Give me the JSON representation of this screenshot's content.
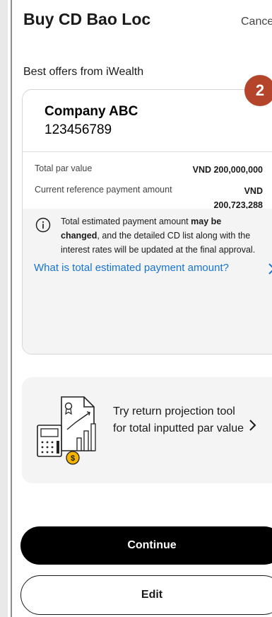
{
  "header": {
    "title": "Buy CD Bao Loc",
    "cancel_label": "Cance"
  },
  "section_title": "Best offers from iWealth",
  "step_badge": "2",
  "offer": {
    "company_name": "Company ABC",
    "company_code": "123456789",
    "rows": [
      {
        "label": "Total par value",
        "value": "VND 200,000,000"
      },
      {
        "label": "Current reference payment amount",
        "value_line1": "VND",
        "value_line2": "200,723,288"
      }
    ],
    "note": {
      "text_before": "Total estimated payment amount ",
      "text_bold": "may be changed",
      "text_after": ", and the detailed CD list along with the interest rates will be updated at the final approval."
    },
    "link_label": "What is total estimated payment amount?"
  },
  "promo": {
    "text": "Try return projection tool for total inputted par value"
  },
  "buttons": {
    "continue_label": "Continue",
    "edit_label": "Edit"
  },
  "colors": {
    "badge": "#b5452a",
    "link": "#1673d6",
    "primary_button": "#000000",
    "coin": "#f5b400"
  },
  "icons": [
    "info-icon",
    "chevron-right-icon",
    "return-projection-illustration"
  ]
}
